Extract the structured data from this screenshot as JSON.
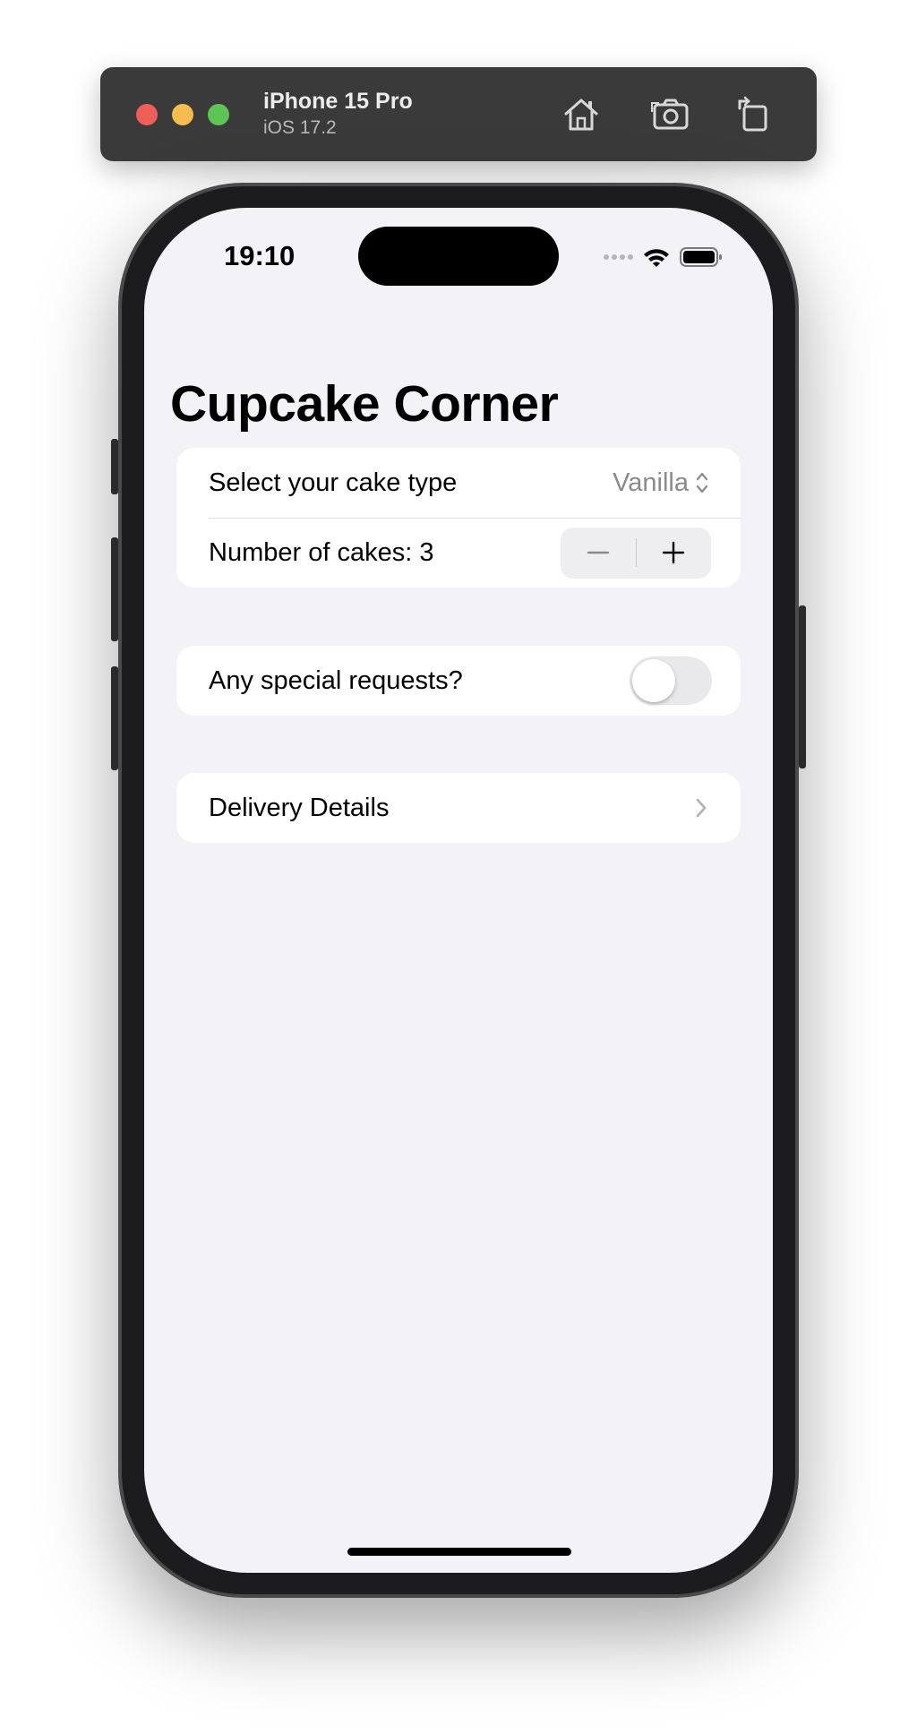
{
  "simulator": {
    "device_name": "iPhone 15 Pro",
    "os_version": "iOS 17.2",
    "icons": [
      "home-icon",
      "screenshot-icon",
      "rotate-icon"
    ]
  },
  "status_bar": {
    "time": "19:10",
    "icons": [
      "cellular-signal-icon",
      "wifi-icon",
      "battery-icon"
    ]
  },
  "navigation": {
    "title": "Cupcake Corner"
  },
  "order_section": {
    "cake_type_label": "Select your cake type",
    "cake_type_value": "Vanilla",
    "quantity_label": "Number of cakes: 3"
  },
  "special_section": {
    "toggle_label": "Any special requests?",
    "toggle_on": false
  },
  "delivery_section": {
    "link_label": "Delivery Details"
  },
  "colors": {
    "background": "#f2f2f7",
    "secondary_text": "#8a8a8e",
    "toggle_off": "#e9e9eb"
  }
}
